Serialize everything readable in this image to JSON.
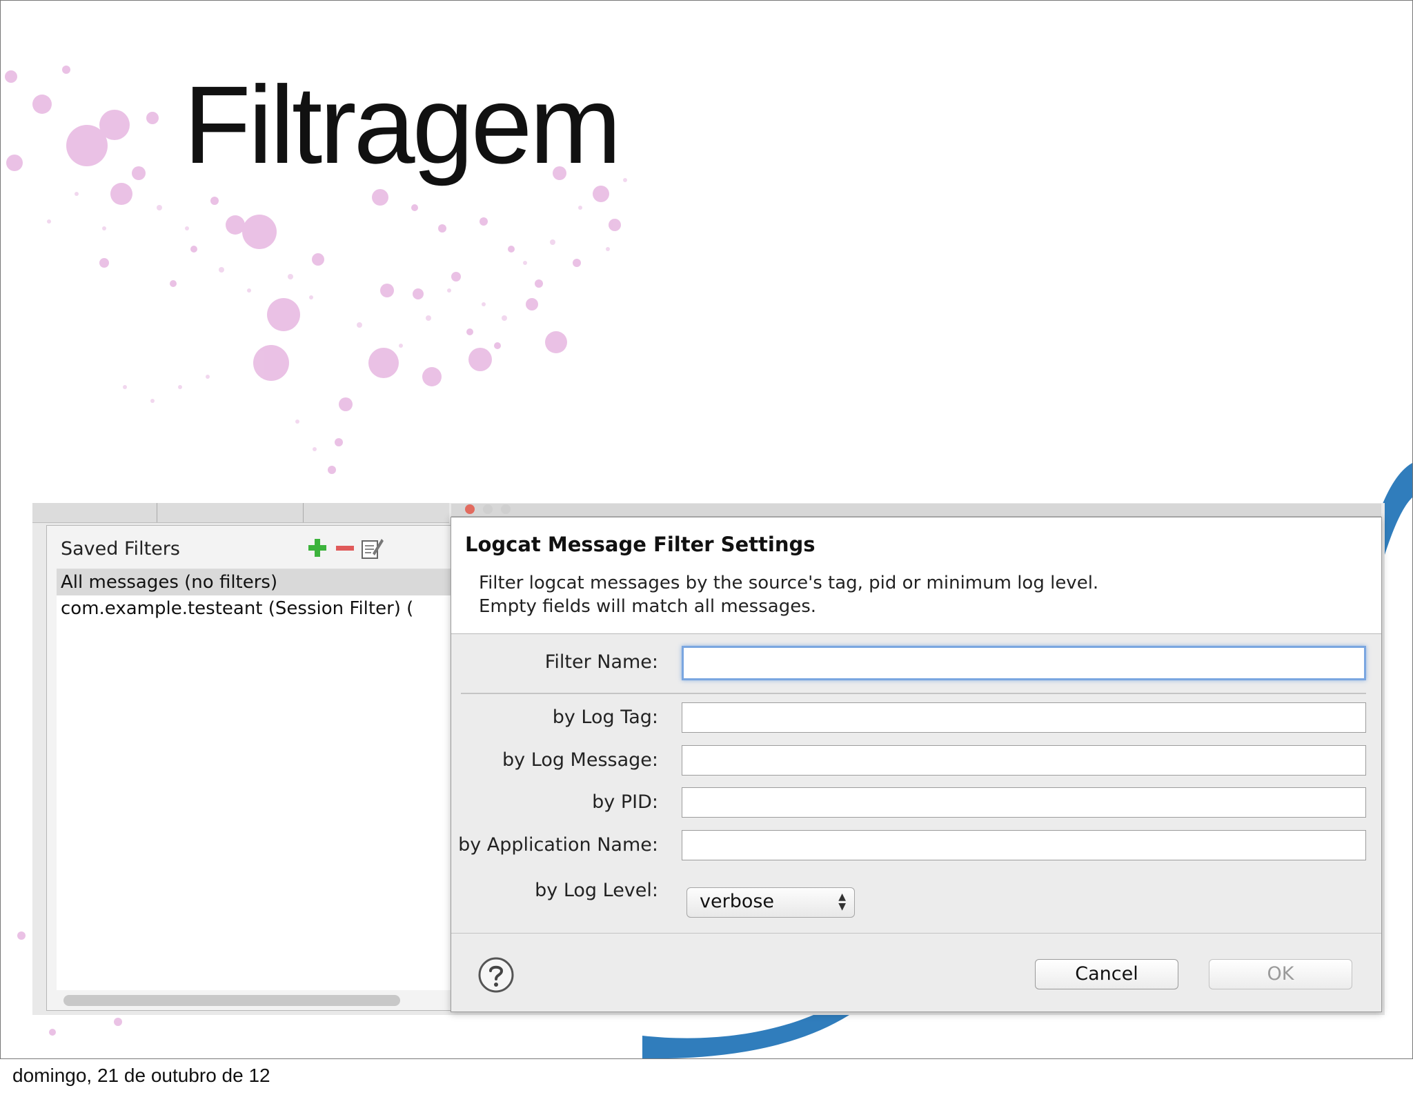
{
  "slide": {
    "title": "Filtragem",
    "footer": "domingo, 21 de outubro de 12"
  },
  "saved_filters": {
    "title": "Saved Filters",
    "items": [
      {
        "label": "All messages (no filters)",
        "selected": true
      },
      {
        "label": "com.example.testeant (Session Filter) (",
        "selected": false
      }
    ],
    "add_icon": "plus-icon",
    "remove_icon": "minus-icon",
    "edit_icon": "edit-icon"
  },
  "dialog": {
    "title": "Logcat Message Filter Settings",
    "description_line1": "Filter logcat messages by the source's tag, pid or minimum log level.",
    "description_line2": "Empty fields will match all messages.",
    "fields": {
      "filter_name": {
        "label": "Filter Name:",
        "value": ""
      },
      "log_tag": {
        "label": "by Log Tag:",
        "value": ""
      },
      "log_message": {
        "label": "by Log Message:",
        "value": ""
      },
      "pid": {
        "label": "by PID:",
        "value": ""
      },
      "app_name": {
        "label": "by Application Name:",
        "value": ""
      },
      "log_level": {
        "label": "by Log Level:",
        "value": "verbose"
      }
    },
    "help_icon": "help-icon",
    "cancel_label": "Cancel",
    "ok_label": "OK"
  },
  "colors": {
    "add_green": "#3cb33c",
    "remove_red": "#e05a5a",
    "focus_blue": "#7aa6e0",
    "deco_pink": "#d98fd0",
    "deco_blue": "#1a6fb5"
  }
}
